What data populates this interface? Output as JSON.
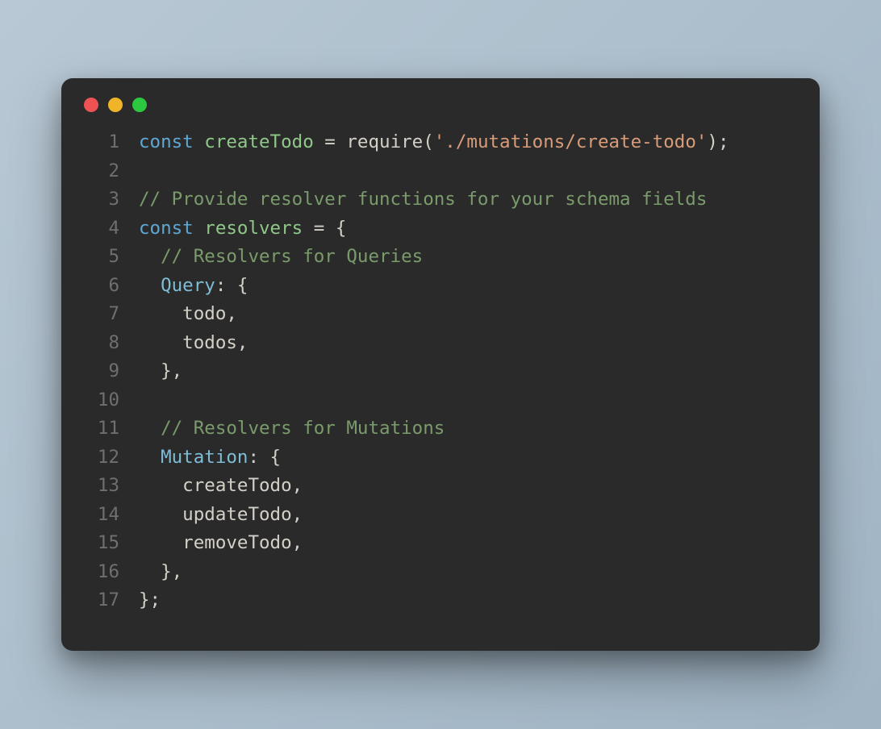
{
  "window": {
    "traffic_lights": [
      "red",
      "yellow",
      "green"
    ]
  },
  "code": {
    "lines": [
      {
        "n": "1",
        "tokens": [
          {
            "cls": "tok-keyword",
            "t": "const"
          },
          {
            "cls": "tok-plain",
            "t": " "
          },
          {
            "cls": "tok-ident",
            "t": "createTodo"
          },
          {
            "cls": "tok-plain",
            "t": " "
          },
          {
            "cls": "tok-punct",
            "t": "="
          },
          {
            "cls": "tok-plain",
            "t": " "
          },
          {
            "cls": "tok-func",
            "t": "require"
          },
          {
            "cls": "tok-punct",
            "t": "("
          },
          {
            "cls": "tok-string",
            "t": "'./mutations/create-todo'"
          },
          {
            "cls": "tok-punct",
            "t": ");"
          }
        ]
      },
      {
        "n": "2",
        "tokens": []
      },
      {
        "n": "3",
        "tokens": [
          {
            "cls": "tok-comment",
            "t": "// Provide resolver functions for your schema fields"
          }
        ]
      },
      {
        "n": "4",
        "tokens": [
          {
            "cls": "tok-keyword",
            "t": "const"
          },
          {
            "cls": "tok-plain",
            "t": " "
          },
          {
            "cls": "tok-ident",
            "t": "resolvers"
          },
          {
            "cls": "tok-plain",
            "t": " "
          },
          {
            "cls": "tok-punct",
            "t": "="
          },
          {
            "cls": "tok-plain",
            "t": " "
          },
          {
            "cls": "tok-punct",
            "t": "{"
          }
        ]
      },
      {
        "n": "5",
        "tokens": [
          {
            "cls": "tok-plain",
            "t": "  "
          },
          {
            "cls": "tok-comment",
            "t": "// Resolvers for Queries"
          }
        ]
      },
      {
        "n": "6",
        "tokens": [
          {
            "cls": "tok-plain",
            "t": "  "
          },
          {
            "cls": "tok-prop",
            "t": "Query"
          },
          {
            "cls": "tok-punct",
            "t": ": {"
          }
        ]
      },
      {
        "n": "7",
        "tokens": [
          {
            "cls": "tok-plain",
            "t": "    todo"
          },
          {
            "cls": "tok-punct",
            "t": ","
          }
        ]
      },
      {
        "n": "8",
        "tokens": [
          {
            "cls": "tok-plain",
            "t": "    todos"
          },
          {
            "cls": "tok-punct",
            "t": ","
          }
        ]
      },
      {
        "n": "9",
        "tokens": [
          {
            "cls": "tok-plain",
            "t": "  "
          },
          {
            "cls": "tok-punct",
            "t": "},"
          }
        ]
      },
      {
        "n": "10",
        "tokens": []
      },
      {
        "n": "11",
        "tokens": [
          {
            "cls": "tok-plain",
            "t": "  "
          },
          {
            "cls": "tok-comment",
            "t": "// Resolvers for Mutations"
          }
        ]
      },
      {
        "n": "12",
        "tokens": [
          {
            "cls": "tok-plain",
            "t": "  "
          },
          {
            "cls": "tok-prop",
            "t": "Mutation"
          },
          {
            "cls": "tok-punct",
            "t": ": {"
          }
        ]
      },
      {
        "n": "13",
        "tokens": [
          {
            "cls": "tok-plain",
            "t": "    createTodo"
          },
          {
            "cls": "tok-punct",
            "t": ","
          }
        ]
      },
      {
        "n": "14",
        "tokens": [
          {
            "cls": "tok-plain",
            "t": "    updateTodo"
          },
          {
            "cls": "tok-punct",
            "t": ","
          }
        ]
      },
      {
        "n": "15",
        "tokens": [
          {
            "cls": "tok-plain",
            "t": "    removeTodo"
          },
          {
            "cls": "tok-punct",
            "t": ","
          }
        ]
      },
      {
        "n": "16",
        "tokens": [
          {
            "cls": "tok-plain",
            "t": "  "
          },
          {
            "cls": "tok-punct",
            "t": "},"
          }
        ]
      },
      {
        "n": "17",
        "tokens": [
          {
            "cls": "tok-punct",
            "t": "};"
          }
        ]
      }
    ]
  }
}
